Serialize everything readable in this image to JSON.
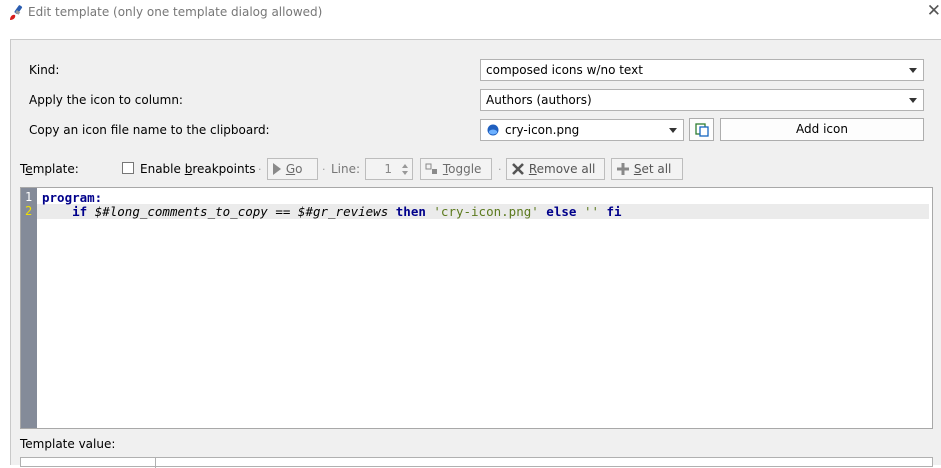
{
  "window": {
    "title": "Edit template (only one template dialog allowed)",
    "close_glyph": "✕",
    "app_icon": "paintbrush-icon"
  },
  "form": {
    "kind_label": "Kind:",
    "kind_value": "composed icons w/no text",
    "column_label": "Apply the icon to column:",
    "column_value": "Authors (authors)",
    "copy_label": "Copy an icon file name to the clipboard:",
    "icon_value": "cry-icon.png",
    "copy_button_icon": "copy-icon",
    "add_icon_label": "Add icon"
  },
  "toolbar": {
    "template_prefix": "T",
    "template_mnemonic": "e",
    "template_suffix": "mplate:",
    "enable_prefix": "Enable ",
    "enable_mnemonic": "b",
    "enable_suffix": "reakpoints",
    "go_mnemonic": "G",
    "go_suffix": "o",
    "line_label": "Line:",
    "line_value": "1",
    "toggle_mnemonic": "T",
    "toggle_suffix": "oggle",
    "remove_mnemonic": "R",
    "remove_suffix": "emove all",
    "set_mnemonic": "S",
    "set_suffix": "et all"
  },
  "editor": {
    "line_numbers": [
      "1",
      "2"
    ],
    "line1": {
      "keyword": "program:"
    },
    "line2": {
      "indent": "    ",
      "kw_if": "if",
      "var1": "$#long_comments_to_copy",
      "op": "==",
      "var2": "$#gr_reviews",
      "kw_then": "then",
      "str1": "'cry-icon.png'",
      "kw_else": "else",
      "str2": "''",
      "kw_fi": "fi"
    }
  },
  "template_value": {
    "label": "Template value:"
  },
  "colors": {
    "gutter": "#848b99",
    "keyword": "#00008b",
    "string": "#5c7a1e",
    "current_line": "#ebebeb",
    "line1_number": "#0000cc",
    "line2_number": "#cccc00"
  }
}
